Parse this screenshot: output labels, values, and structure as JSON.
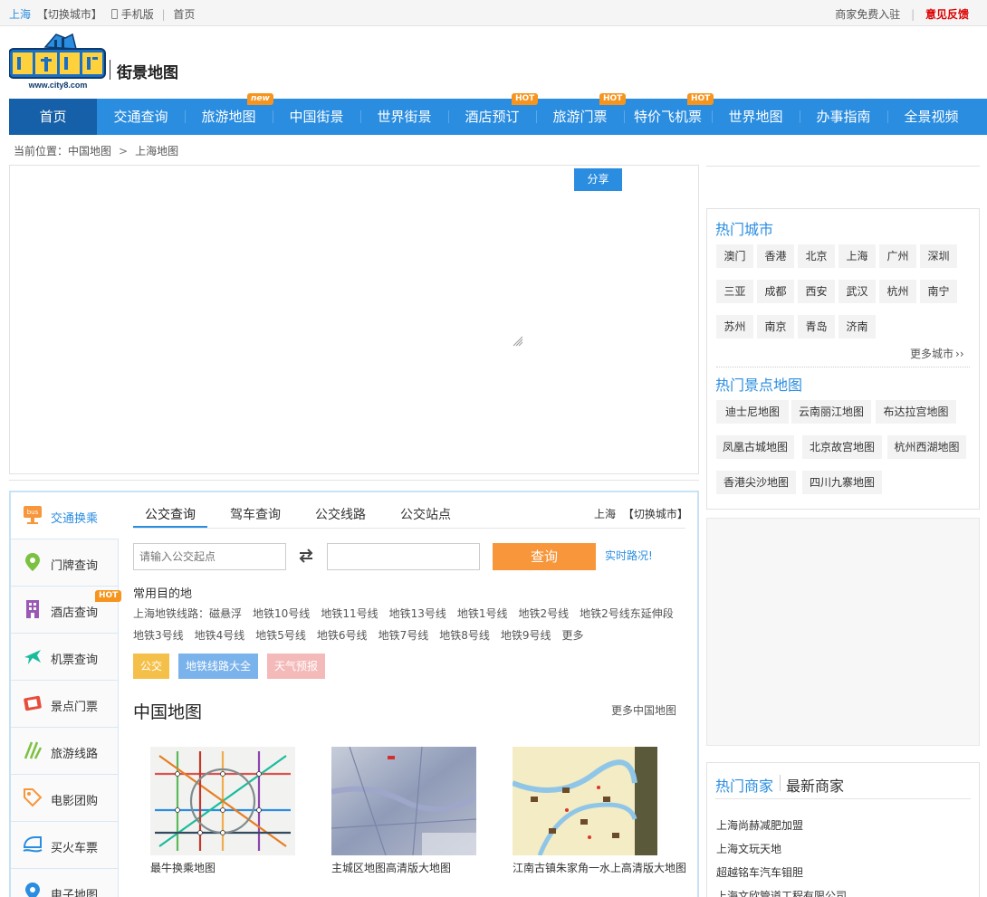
{
  "topbar": {
    "city": "上海",
    "switch_city": "【切换城市】",
    "mobile": "手机版",
    "home": "首页",
    "merchant_join": "商家免费入驻",
    "feedback": "意见反馈"
  },
  "header": {
    "logo_url_text": "www.city8.com",
    "subtitle": "街景地图"
  },
  "nav": [
    {
      "label": "首页",
      "badge": ""
    },
    {
      "label": "交通查询",
      "badge": ""
    },
    {
      "label": "旅游地图",
      "badge": "new"
    },
    {
      "label": "中国街景",
      "badge": ""
    },
    {
      "label": "世界街景",
      "badge": ""
    },
    {
      "label": "酒店预订",
      "badge": "HOT"
    },
    {
      "label": "旅游门票",
      "badge": "HOT"
    },
    {
      "label": "特价飞机票",
      "badge": "HOT"
    },
    {
      "label": "世界地图",
      "badge": ""
    },
    {
      "label": "办事指南",
      "badge": ""
    },
    {
      "label": "全景视频",
      "badge": ""
    }
  ],
  "breadcrumb": {
    "prefix": "当前位置：",
    "level1": "中国地图",
    "separator": ">",
    "level2": "上海地图"
  },
  "map": {
    "share_label": "分享"
  },
  "hot_cities": {
    "title": "热门城市",
    "items": [
      "澳门",
      "香港",
      "北京",
      "上海",
      "广州",
      "深圳",
      "三亚",
      "成都",
      "西安",
      "武汉",
      "杭州",
      "南宁",
      "苏州",
      "南京",
      "青岛",
      "济南"
    ],
    "more": "更多城市"
  },
  "hot_spots": {
    "title": "热门景点地图",
    "items": [
      "迪士尼地图",
      "云南丽江地图",
      "布达拉宫地图",
      "凤凰古城地图",
      "北京故宫地图",
      "杭州西湖地图",
      "香港尖沙地图",
      "四川九寨地图"
    ]
  },
  "merchants": {
    "tab_hot": "热门商家",
    "tab_new": "最新商家",
    "items": [
      "上海尚赫减肥加盟",
      "上海文玩天地",
      "超越铭车汽车钼胆",
      "上海文欣管道工程有限公司"
    ]
  },
  "sidebar": [
    {
      "label": "交通换乘",
      "icon": "bus-icon",
      "badge": "",
      "icon_text": "bus"
    },
    {
      "label": "门牌查询",
      "icon": "location-pin-icon",
      "badge": ""
    },
    {
      "label": "酒店查询",
      "icon": "hotel-building-icon",
      "badge": "HOT"
    },
    {
      "label": "机票查询",
      "icon": "airplane-icon",
      "badge": ""
    },
    {
      "label": "景点门票",
      "icon": "ticket-icon",
      "badge": ""
    },
    {
      "label": "旅游线路",
      "icon": "route-icon",
      "badge": ""
    },
    {
      "label": "电影团购",
      "icon": "tag-icon",
      "badge": ""
    },
    {
      "label": "买火车票",
      "icon": "train-icon",
      "badge": ""
    },
    {
      "label": "电子地图",
      "icon": "map-pin-icon",
      "badge": ""
    }
  ],
  "query": {
    "tabs": [
      "公交查询",
      "驾车查询",
      "公交线路",
      "公交站点"
    ],
    "city": "上海",
    "switch_city": "【切换城市】",
    "start_placeholder": "请输入公交起点",
    "end_placeholder": "",
    "search_label": "查询",
    "realtime_label": "实时路况!",
    "common_title": "常用目的地",
    "metro_prefix": "上海地铁线路：",
    "lines_row1": [
      "磁悬浮",
      "地铁10号线",
      "地铁11号线",
      "地铁13号线",
      "地铁1号线",
      "地铁2号线",
      "地铁2号线东延伸段"
    ],
    "lines_row2": [
      "地铁3号线",
      "地铁4号线",
      "地铁5号线",
      "地铁6号线",
      "地铁7号线",
      "地铁8号线",
      "地铁9号线",
      "更多"
    ],
    "pills": [
      {
        "label": "公交",
        "color": "#f5c04a"
      },
      {
        "label": "地铁线路大全",
        "color": "#7ab3ec"
      },
      {
        "label": "天气预报",
        "color": "#f4b9b9"
      }
    ]
  },
  "china_maps": {
    "title": "中国地图",
    "more": "更多中国地图",
    "items": [
      {
        "caption": "最牛换乘地图"
      },
      {
        "caption": "主城区地图高清版大地图"
      },
      {
        "caption": "江南古镇朱家角一水上高清版大地图"
      }
    ]
  },
  "colors": {
    "accent": "#2a8de0",
    "nav_active": "#1560a8",
    "badge": "#f7941d",
    "search_button": "#f7963a",
    "feedback": "#dd0000"
  }
}
